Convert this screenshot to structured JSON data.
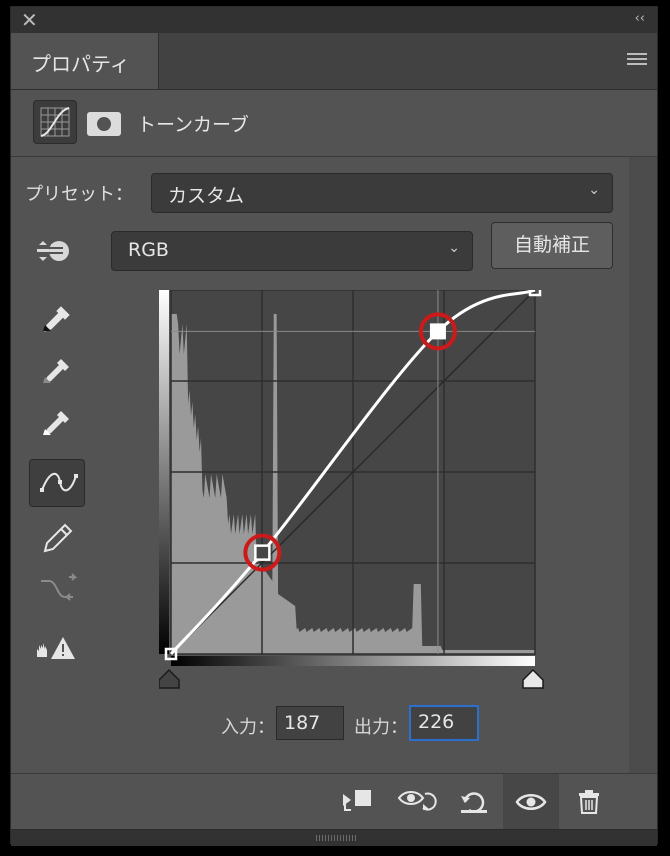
{
  "panel": {
    "tab_label": "プロパティ",
    "adjustment_title": "トーンカーブ"
  },
  "preset": {
    "label": "プリセット：",
    "value": "カスタム"
  },
  "channel": {
    "value": "RGB"
  },
  "auto_button": "自動補正",
  "io": {
    "input_label": "入力：",
    "input_value": "187",
    "output_label": "出力：",
    "output_value": "226"
  },
  "tools": [
    "target-adjust-tool",
    "black-point-eyedropper",
    "gray-point-eyedropper",
    "white-point-eyedropper",
    "edit-points-curve-tool",
    "pencil-draw-tool",
    "smooth-curve-tool",
    "clipping-warning-tool"
  ],
  "curve": {
    "points": [
      [
        0,
        0
      ],
      [
        64,
        71
      ],
      [
        187,
        226
      ],
      [
        255,
        255
      ]
    ],
    "selected_point": [
      187,
      226
    ],
    "highlight_color": "#cc1a1a"
  },
  "footer_icons": [
    "clip-to-layer-icon",
    "view-previous-state-icon",
    "reset-icon",
    "visibility-icon",
    "trash-icon"
  ]
}
